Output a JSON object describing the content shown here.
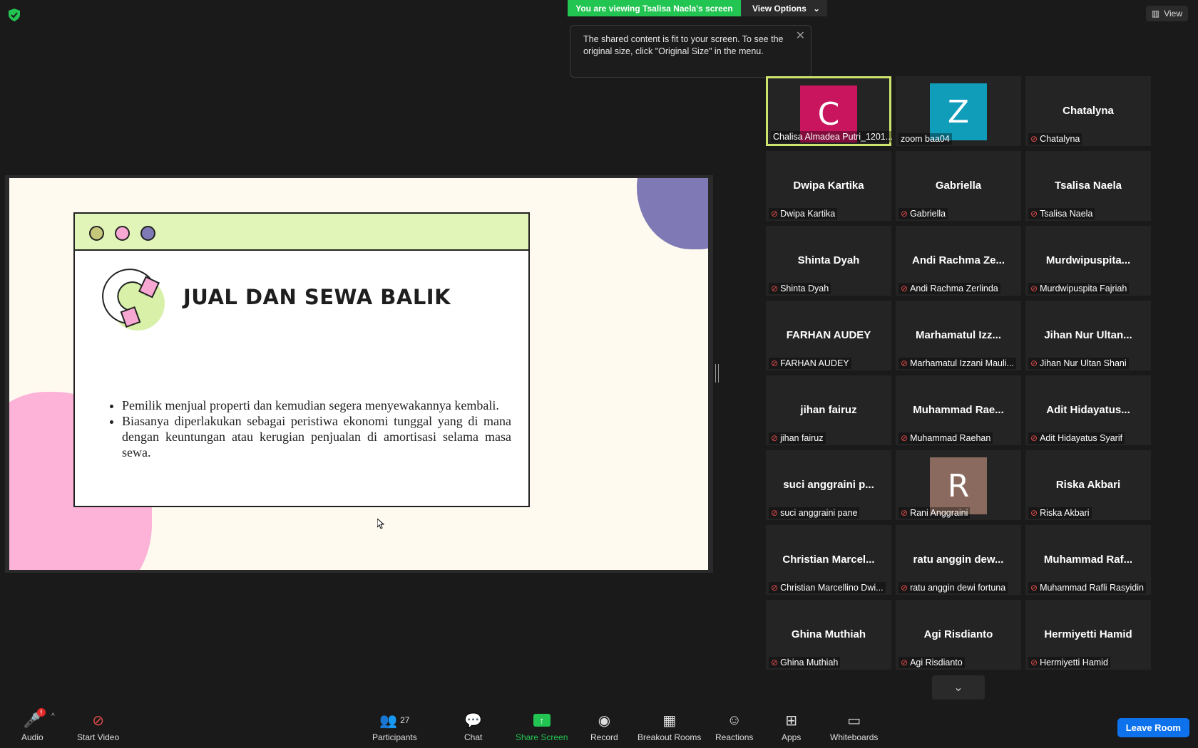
{
  "banner": {
    "viewing_text": "You are viewing Tsalisa Naela's screen",
    "view_options": "View Options"
  },
  "view_button": "View",
  "tooltip": {
    "text": "The shared content is fit to your screen. To see the original size, click \"Original Size\" in the menu."
  },
  "slide": {
    "title": "JUAL DAN SEWA BALIK",
    "bullets": [
      "Pemilik menjual properti dan kemudian segera menyewakannya kembali.",
      "Biasanya diperlakukan sebagai peristiwa ekonomi tunggal yang di mana dengan keuntungan atau kerugian penjualan di amortisasi selama masa sewa."
    ],
    "colors": {
      "bar": "#e2f5b8",
      "dot1": "#c5c87a",
      "dot2": "#f7a8d2",
      "dot3": "#7f79b5",
      "purple_blob": "#7f79b5",
      "pink_blob": "#fcb3d7"
    }
  },
  "participants": [
    {
      "display": "C",
      "label": "Chalisa Almadea Putri_1201...",
      "avatar_color": "#c8155e",
      "muted": false,
      "active": true
    },
    {
      "display": "Z",
      "label": "zoom baa04",
      "avatar_color": "#0f9dba",
      "muted": false
    },
    {
      "display": "Chatalyna",
      "label": "Chatalyna",
      "muted": true
    },
    {
      "display": "Dwipa Kartika",
      "label": "Dwipa Kartika",
      "muted": true
    },
    {
      "display": "Gabriella",
      "label": "Gabriella",
      "muted": true
    },
    {
      "display": "Tsalisa Naela",
      "label": "Tsalisa Naela",
      "muted": true
    },
    {
      "display": "Shinta Dyah",
      "label": "Shinta Dyah",
      "muted": true
    },
    {
      "display": "Andi Rachma Ze...",
      "label": "Andi Rachma Zerlinda",
      "muted": true
    },
    {
      "display": "Murdwipuspita...",
      "label": "Murdwipuspita Fajriah",
      "muted": true
    },
    {
      "display": "FARHAN AUDEY",
      "label": "FARHAN AUDEY",
      "muted": true
    },
    {
      "display": "Marhamatul Izz...",
      "label": "Marhamatul Izzani Mauli...",
      "muted": true
    },
    {
      "display": "Jihan Nur Ultan...",
      "label": "Jihan Nur Ultan Shani",
      "muted": true
    },
    {
      "display": "jihan fairuz",
      "label": "jihan fairuz",
      "muted": true
    },
    {
      "display": "Muhammad Rae...",
      "label": "Muhammad Raehan",
      "muted": true
    },
    {
      "display": "Adit Hidayatus...",
      "label": "Adit Hidayatus Syarif",
      "muted": true
    },
    {
      "display": "suci anggraini p...",
      "label": "suci anggraini pane",
      "muted": true
    },
    {
      "display": "R",
      "label": "Rani Anggraini",
      "avatar_color": "#8a6a5e",
      "muted": true
    },
    {
      "display": "Riska Akbari",
      "label": "Riska Akbari",
      "muted": true
    },
    {
      "display": "Christian Marcel...",
      "label": "Christian Marcellino Dwi...",
      "muted": true
    },
    {
      "display": "ratu anggin dew...",
      "label": "ratu anggin dewi fortuna",
      "muted": true
    },
    {
      "display": "Muhammad Raf...",
      "label": "Muhammad Rafli Rasyidin",
      "muted": true
    },
    {
      "display": "Ghina Muthiah",
      "label": "Ghina Muthiah",
      "muted": true
    },
    {
      "display": "Agi Risdianto",
      "label": "Agi Risdianto",
      "muted": true
    },
    {
      "display": "Hermiyetti Hamid",
      "label": "Hermiyetti Hamid",
      "muted": true
    }
  ],
  "toolbar": {
    "audio": "Audio",
    "audio_badge": "!",
    "start_video": "Start Video",
    "participants": "Participants",
    "participants_count": "27",
    "chat": "Chat",
    "share_screen": "Share Screen",
    "record": "Record",
    "breakout_rooms": "Breakout Rooms",
    "reactions": "Reactions",
    "apps": "Apps",
    "whiteboards": "Whiteboards",
    "leave": "Leave Room"
  }
}
